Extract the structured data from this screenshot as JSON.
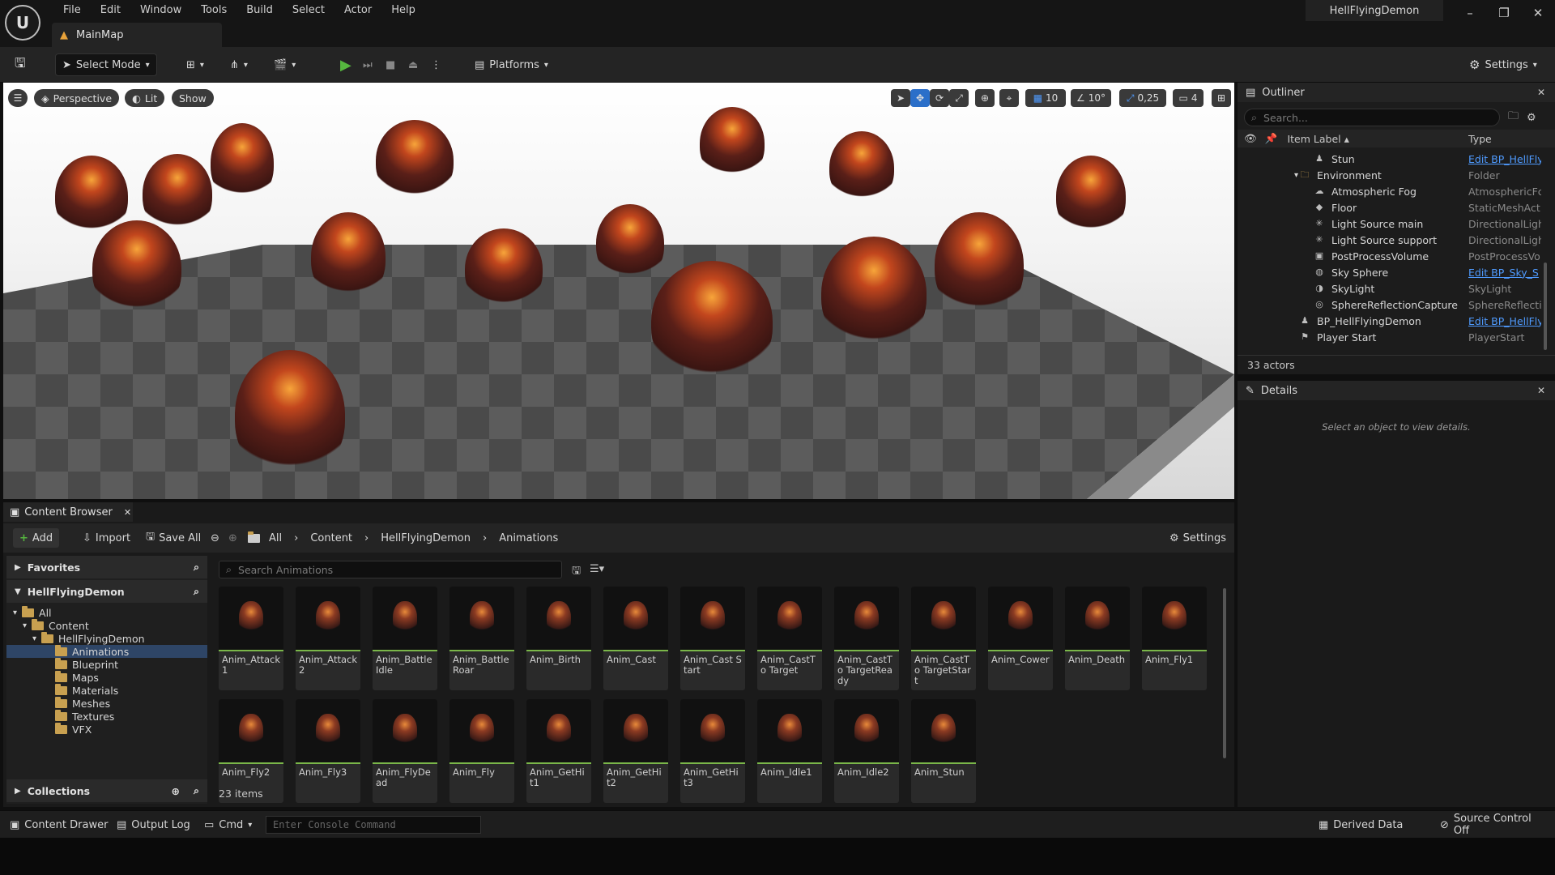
{
  "app": {
    "menu": [
      "File",
      "Edit",
      "Window",
      "Tools",
      "Build",
      "Select",
      "Actor",
      "Help"
    ],
    "map_tab": "MainMap",
    "project_name": "HellFlyingDemon",
    "window_controls": {
      "minimize": "–",
      "restore": "❐",
      "close": "✕"
    }
  },
  "toolbar": {
    "select_mode": "Select Mode",
    "platforms": "Platforms",
    "settings": "Settings"
  },
  "viewport": {
    "perspective": "Perspective",
    "lit": "Lit",
    "show": "Show",
    "grid_snap": "10",
    "angle_snap": "10°",
    "scale_snap": "0,25",
    "camera_speed": "4"
  },
  "outliner": {
    "title": "Outliner",
    "search_placeholder": "Search...",
    "col_label": "Item Label ▴",
    "col_type": "Type",
    "rows": [
      {
        "label": "Stun",
        "type": "Edit BP_HellFly",
        "link": true,
        "indent": 1,
        "icon": "pawn-icon"
      },
      {
        "label": "Environment",
        "type": "Folder",
        "link": false,
        "indent": 0,
        "icon": "folder-icon"
      },
      {
        "label": "Atmospheric Fog",
        "type": "AtmosphericFc",
        "link": false,
        "indent": 1,
        "icon": "cloud-icon"
      },
      {
        "label": "Floor",
        "type": "StaticMeshAct",
        "link": false,
        "indent": 1,
        "icon": "mesh-icon"
      },
      {
        "label": "Light Source main",
        "type": "DirectionalLigh",
        "link": false,
        "indent": 1,
        "icon": "sun-icon"
      },
      {
        "label": "Light Source support",
        "type": "DirectionalLigh",
        "link": false,
        "indent": 1,
        "icon": "sun-icon"
      },
      {
        "label": "PostProcessVolume",
        "type": "PostProcessVo",
        "link": false,
        "indent": 1,
        "icon": "volume-icon"
      },
      {
        "label": "Sky Sphere",
        "type": "Edit BP_Sky_S",
        "link": true,
        "indent": 1,
        "icon": "sphere-icon"
      },
      {
        "label": "SkyLight",
        "type": "SkyLight",
        "link": false,
        "indent": 1,
        "icon": "skylight-icon"
      },
      {
        "label": "SphereReflectionCapture",
        "type": "SphereReflecti",
        "link": false,
        "indent": 1,
        "icon": "reflection-icon"
      },
      {
        "label": "BP_HellFlyingDemon",
        "type": "Edit BP_HellFly",
        "link": true,
        "indent": 0,
        "icon": "pawn-icon"
      },
      {
        "label": "Player Start",
        "type": "PlayerStart",
        "link": false,
        "indent": 0,
        "icon": "flag-icon"
      }
    ],
    "actor_count": "33 actors"
  },
  "details": {
    "title": "Details",
    "empty_message": "Select an object to view details."
  },
  "content_browser": {
    "tab": "Content Browser",
    "add": "Add",
    "import": "Import",
    "save_all": "Save All",
    "breadcrumb": [
      "All",
      "Content",
      "HellFlyingDemon",
      "Animations"
    ],
    "settings": "Settings",
    "favorites": "Favorites",
    "project_root": "HellFlyingDemon",
    "tree": [
      {
        "label": "All",
        "indent": 0
      },
      {
        "label": "Content",
        "indent": 1
      },
      {
        "label": "HellFlyingDemon",
        "indent": 2
      },
      {
        "label": "Animations",
        "indent": 3,
        "selected": true
      },
      {
        "label": "Blueprint",
        "indent": 3
      },
      {
        "label": "Maps",
        "indent": 3
      },
      {
        "label": "Materials",
        "indent": 3
      },
      {
        "label": "Meshes",
        "indent": 3
      },
      {
        "label": "Textures",
        "indent": 3
      },
      {
        "label": "VFX",
        "indent": 3
      }
    ],
    "collections": "Collections",
    "search_placeholder": "Search Animations",
    "assets": [
      "Anim_Attack1",
      "Anim_Attack2",
      "Anim_Battle Idle",
      "Anim_Battle Roar",
      "Anim_Birth",
      "Anim_Cast",
      "Anim_Cast Start",
      "Anim_CastTo Target",
      "Anim_CastTo TargetReady",
      "Anim_CastTo TargetStart",
      "Anim_Cower",
      "Anim_Death",
      "Anim_Fly1",
      "Anim_Fly2",
      "Anim_Fly3",
      "Anim_FlyDead",
      "Anim_Fly",
      "Anim_GetHit1",
      "Anim_GetHit2",
      "Anim_GetHit3",
      "Anim_Idle1",
      "Anim_Idle2",
      "Anim_Stun"
    ],
    "item_count": "23 items"
  },
  "statusbar": {
    "content_drawer": "Content Drawer",
    "output_log": "Output Log",
    "cmd": "Cmd",
    "console_placeholder": "Enter Console Command",
    "derived_data": "Derived Data",
    "source_control": "Source Control Off"
  },
  "colors": {
    "accent": "#4f9bff",
    "play": "#56b63f",
    "folder": "#c8a050",
    "panel": "#1c1c1c"
  }
}
